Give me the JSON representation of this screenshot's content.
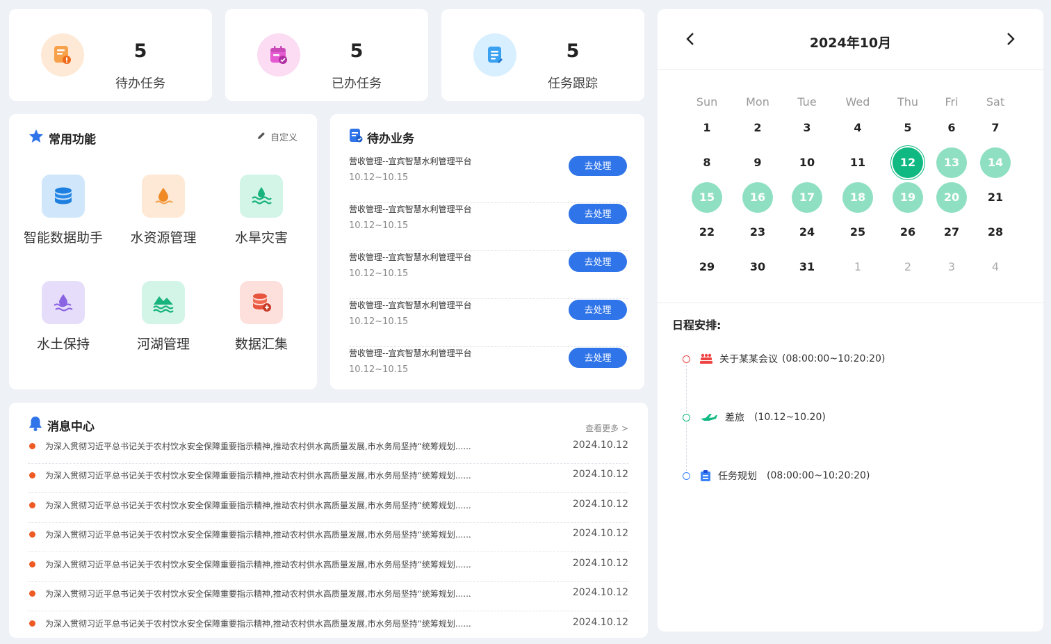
{
  "stats": [
    {
      "value": "5",
      "label": "待办任务"
    },
    {
      "value": "5",
      "label": "已办任务"
    },
    {
      "value": "5",
      "label": "任务跟踪"
    }
  ],
  "common": {
    "title": "常用功能",
    "customize": "自定义",
    "items": [
      {
        "label": "智能数据助手",
        "icon": "database-icon"
      },
      {
        "label": "水资源管理",
        "icon": "water-drop-icon"
      },
      {
        "label": "水旱灾害",
        "icon": "flood-icon"
      },
      {
        "label": "水土保持",
        "icon": "soil-conservation-icon"
      },
      {
        "label": "河湖管理",
        "icon": "river-icon"
      },
      {
        "label": "数据汇集",
        "icon": "data-collect-icon"
      }
    ]
  },
  "pending": {
    "title": "待办业务",
    "items": [
      {
        "title": "营收管理--宜宾智慧水利管理平台",
        "date": "10.12~10.15",
        "action": "去处理"
      },
      {
        "title": "营收管理--宜宾智慧水利管理平台",
        "date": "10.12~10.15",
        "action": "去处理"
      },
      {
        "title": "营收管理--宜宾智慧水利管理平台",
        "date": "10.12~10.15",
        "action": "去处理"
      },
      {
        "title": "营收管理--宜宾智慧水利管理平台",
        "date": "10.12~10.15",
        "action": "去处理"
      },
      {
        "title": "营收管理--宜宾智慧水利管理平台",
        "date": "10.12~10.15",
        "action": "去处理"
      }
    ]
  },
  "messages": {
    "title": "消息中心",
    "more": "查看更多 >",
    "items": [
      {
        "text": "为深入贯彻习近平总书记关于农村饮水安全保障重要指示精神,推动农村供水高质量发展,市水务局坚持“统筹规划......",
        "date": "2024.10.12"
      },
      {
        "text": "为深入贯彻习近平总书记关于农村饮水安全保障重要指示精神,推动农村供水高质量发展,市水务局坚持“统筹规划......",
        "date": "2024.10.12"
      },
      {
        "text": "为深入贯彻习近平总书记关于农村饮水安全保障重要指示精神,推动农村供水高质量发展,市水务局坚持“统筹规划......",
        "date": "2024.10.12"
      },
      {
        "text": "为深入贯彻习近平总书记关于农村饮水安全保障重要指示精神,推动农村供水高质量发展,市水务局坚持“统筹规划......",
        "date": "2024.10.12"
      },
      {
        "text": "为深入贯彻习近平总书记关于农村饮水安全保障重要指示精神,推动农村供水高质量发展,市水务局坚持“统筹规划......",
        "date": "2024.10.12"
      },
      {
        "text": "为深入贯彻习近平总书记关于农村饮水安全保障重要指示精神,推动农村供水高质量发展,市水务局坚持“统筹规划......",
        "date": "2024.10.12"
      },
      {
        "text": "为深入贯彻习近平总书记关于农村饮水安全保障重要指示精神,推动农村供水高质量发展,市水务局坚持“统筹规划......",
        "date": "2024.10.12"
      }
    ]
  },
  "calendar": {
    "month_title": "2024年10月",
    "weekdays": [
      "Sun",
      "Mon",
      "Tue",
      "Wed",
      "Thu",
      "Fri",
      "Sat"
    ],
    "weeks": [
      [
        "1",
        "2",
        "3",
        "4",
        "5",
        "6",
        "7"
      ],
      [
        "8",
        "9",
        "10",
        "11",
        "12",
        "13",
        "14"
      ],
      [
        "15",
        "16",
        "17",
        "18",
        "19",
        "20",
        "21"
      ],
      [
        "22",
        "23",
        "24",
        "25",
        "26",
        "27",
        "28"
      ],
      [
        "29",
        "30",
        "31",
        "1",
        "2",
        "3",
        "4"
      ]
    ],
    "today": "12",
    "highlighted": [
      "13",
      "14",
      "15",
      "16",
      "17",
      "18",
      "19",
      "20"
    ],
    "trailing_muted_count": 4,
    "colors": {
      "today": "#10b981",
      "highlight": "#8fe0c2"
    }
  },
  "schedule": {
    "title": "日程安排:",
    "items": [
      {
        "name": "关于某某会议",
        "time": "(08:00:00~10:20:20)",
        "icon": "meeting-icon",
        "color": "#ef4444"
      },
      {
        "name": "差旅",
        "time": "(10.12~10.20)",
        "icon": "airplane-icon",
        "color": "#10b981"
      },
      {
        "name": "任务规划",
        "time": "(08:00:00~10:20:20)",
        "icon": "clipboard-icon",
        "color": "#3b82f6"
      }
    ]
  }
}
